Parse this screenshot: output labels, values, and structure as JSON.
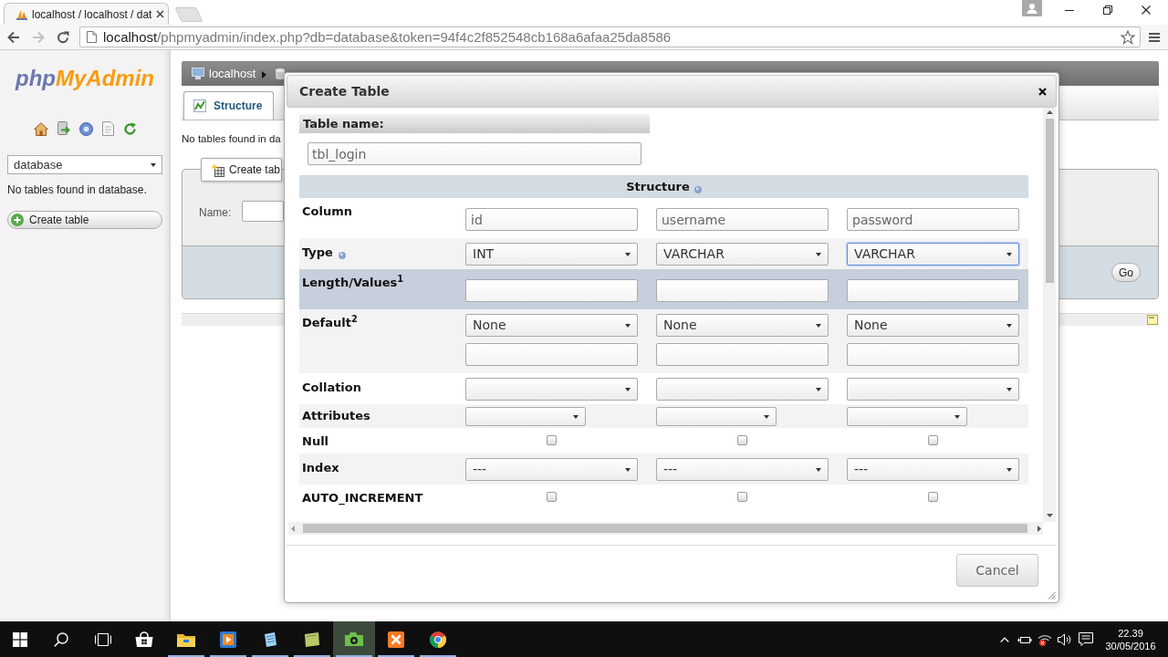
{
  "browser": {
    "tab": {
      "title": "localhost / localhost / dat"
    },
    "nav": [
      {
        "kind": "back",
        "disabled": false
      },
      {
        "kind": "forward",
        "disabled": true
      },
      {
        "kind": "reload",
        "disabled": false
      }
    ],
    "address": {
      "host": "localhost",
      "path": "/phpmyadmin/index.php?db=database&token=94f4c2f852548cb168a6afaa25da8586"
    }
  },
  "sidebar": {
    "logo": {
      "php": "php",
      "myadmin": "MyAdmin"
    },
    "database_select": {
      "value": "database"
    },
    "message": "No tables found in database.",
    "create_button": "Create table"
  },
  "main": {
    "breadcrumb": {
      "server": "localhost"
    },
    "tabs": [
      {
        "label": "Structure",
        "selected": true
      }
    ],
    "message": "No tables found in da",
    "create_legend": "Create tab",
    "name_label": "Name:",
    "go_button": "Go"
  },
  "dialog": {
    "title": "Create Table",
    "table_name_label": "Table name:",
    "table_name": "tbl_login",
    "structure_heading": "Structure",
    "rows": [
      {
        "label": "Column",
        "kind": "text",
        "help": false,
        "highlighted": false,
        "cells": [
          {
            "value": "id",
            "focused": false
          },
          {
            "value": "username",
            "focused": false
          },
          {
            "value": "password",
            "focused": false
          }
        ]
      },
      {
        "label": "Type",
        "kind": "select",
        "help": true,
        "highlighted": false,
        "cells": [
          {
            "value": "INT",
            "focused": false
          },
          {
            "value": "VARCHAR",
            "focused": false
          },
          {
            "value": "VARCHAR",
            "focused": true
          }
        ]
      },
      {
        "label": "Length/Values$^{1}$",
        "kind": "text",
        "help": false,
        "highlighted": true,
        "cells": [
          {
            "focused": false
          },
          {
            "focused": false
          },
          {
            "focused": false
          }
        ]
      },
      {
        "label": "Default$^{2}$",
        "kind": "select_text",
        "help": false,
        "highlighted": false,
        "cells": [
          {
            "value": "None",
            "focused": false
          },
          {
            "value": "None",
            "focused": false
          },
          {
            "value": "None",
            "focused": false
          }
        ]
      },
      {
        "label": "Collation",
        "kind": "select",
        "help": false,
        "highlighted": false,
        "cells": [
          {
            "focused": false
          },
          {
            "focused": false
          },
          {
            "focused": false
          }
        ]
      },
      {
        "label": "Attributes",
        "kind": "select_small",
        "help": false,
        "highlighted": false,
        "cells": [
          {
            "focused": false
          },
          {
            "focused": false
          },
          {
            "focused": false
          }
        ]
      },
      {
        "label": "Null",
        "kind": "checkbox",
        "help": false,
        "highlighted": false,
        "cells": [
          {
            "checked": false
          },
          {
            "checked": false
          },
          {
            "checked": false
          }
        ]
      },
      {
        "label": "Index",
        "kind": "select",
        "help": false,
        "highlighted": false,
        "cells": [
          {
            "value": "---",
            "focused": false
          },
          {
            "value": "---",
            "focused": false
          },
          {
            "value": "---",
            "focused": false
          }
        ]
      },
      {
        "label": "AUTO_INCREMENT",
        "kind": "checkbox",
        "help": false,
        "highlighted": false,
        "cells": [
          {
            "checked": false
          },
          {
            "checked": false
          },
          {
            "checked": false
          }
        ]
      }
    ],
    "cancel_button": "Cancel"
  },
  "taskbar": {
    "apps": [
      {
        "kind": "store",
        "running": false,
        "active": false
      },
      {
        "kind": "explorer",
        "running": true,
        "active": false
      },
      {
        "kind": "media",
        "running": true,
        "active": false
      },
      {
        "kind": "notepad",
        "running": true,
        "active": false
      },
      {
        "kind": "notes",
        "running": true,
        "active": false
      },
      {
        "kind": "tool",
        "running": true,
        "active": true
      },
      {
        "kind": "xampp",
        "running": true,
        "active": false
      },
      {
        "kind": "chrome",
        "running": true,
        "active": false
      }
    ],
    "time": "22.39",
    "date": "30/05/2016"
  }
}
